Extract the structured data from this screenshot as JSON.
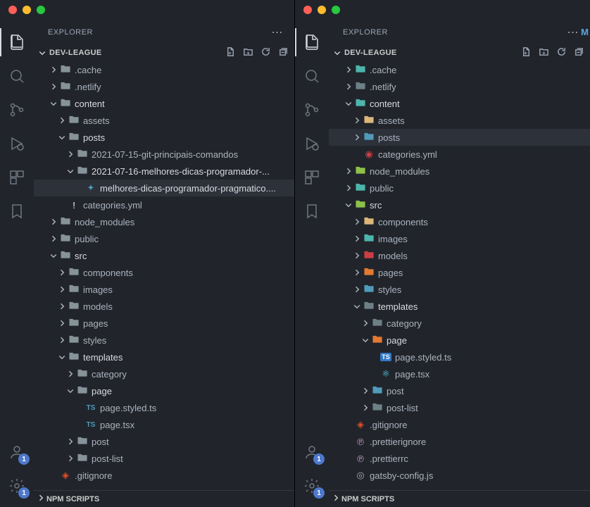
{
  "windows": [
    {
      "explorer_title": "EXPLORER",
      "project_name": "DEV-LEAGUE",
      "npm_scripts": "NPM SCRIPTS",
      "account_badge": "1",
      "settings_badge": "1",
      "tree": [
        {
          "indent": 1,
          "chev": "right",
          "icon": "folder-default",
          "name": ".cache"
        },
        {
          "indent": 1,
          "chev": "right",
          "icon": "folder-default",
          "name": ".netlify"
        },
        {
          "indent": 1,
          "chev": "down",
          "icon": "folder-default",
          "name": "content",
          "bright": true
        },
        {
          "indent": 2,
          "chev": "right",
          "icon": "folder-default",
          "name": "assets"
        },
        {
          "indent": 2,
          "chev": "down",
          "icon": "folder-default",
          "name": "posts",
          "bright": true
        },
        {
          "indent": 3,
          "chev": "right",
          "icon": "folder-default",
          "name": "2021-07-15-git-principais-comandos"
        },
        {
          "indent": 3,
          "chev": "down",
          "icon": "folder-default",
          "name": "2021-07-16-melhores-dicas-programador-...",
          "bright": true
        },
        {
          "indent": 4,
          "chev": "none",
          "icon": "md",
          "name": "melhores-dicas-programador-pragmatico....",
          "selected": true,
          "bright": true
        },
        {
          "indent": 2,
          "chev": "none",
          "icon": "yml",
          "name": "categories.yml"
        },
        {
          "indent": 1,
          "chev": "right",
          "icon": "folder-default",
          "name": "node_modules"
        },
        {
          "indent": 1,
          "chev": "right",
          "icon": "folder-default",
          "name": "public"
        },
        {
          "indent": 1,
          "chev": "down",
          "icon": "folder-default",
          "name": "src",
          "bright": true
        },
        {
          "indent": 2,
          "chev": "right",
          "icon": "folder-default",
          "name": "components"
        },
        {
          "indent": 2,
          "chev": "right",
          "icon": "folder-default",
          "name": "images"
        },
        {
          "indent": 2,
          "chev": "right",
          "icon": "folder-default",
          "name": "models"
        },
        {
          "indent": 2,
          "chev": "right",
          "icon": "folder-default",
          "name": "pages"
        },
        {
          "indent": 2,
          "chev": "right",
          "icon": "folder-default",
          "name": "styles"
        },
        {
          "indent": 2,
          "chev": "down",
          "icon": "folder-default",
          "name": "templates",
          "bright": true
        },
        {
          "indent": 3,
          "chev": "right",
          "icon": "folder-default",
          "name": "category"
        },
        {
          "indent": 3,
          "chev": "down",
          "icon": "folder-default",
          "name": "page",
          "bright": true
        },
        {
          "indent": 4,
          "chev": "none",
          "icon": "ts",
          "name": "page.styled.ts"
        },
        {
          "indent": 4,
          "chev": "none",
          "icon": "ts",
          "name": "page.tsx"
        },
        {
          "indent": 3,
          "chev": "right",
          "icon": "folder-default",
          "name": "post"
        },
        {
          "indent": 3,
          "chev": "right",
          "icon": "folder-default",
          "name": "post-list"
        },
        {
          "indent": 1,
          "chev": "none",
          "icon": "git",
          "name": ".gitignore"
        }
      ]
    },
    {
      "explorer_title": "EXPLORER",
      "project_name": "DEV-LEAGUE",
      "npm_scripts": "NPM SCRIPTS",
      "editor_peek": "M",
      "account_badge": "1",
      "settings_badge": "1",
      "tree": [
        {
          "indent": 1,
          "chev": "right",
          "icon": "folder-teal",
          "name": ".cache"
        },
        {
          "indent": 1,
          "chev": "right",
          "icon": "folder-gray",
          "name": ".netlify"
        },
        {
          "indent": 1,
          "chev": "down",
          "icon": "folder-teal",
          "name": "content",
          "bright": true
        },
        {
          "indent": 2,
          "chev": "right",
          "icon": "folder-yellow",
          "name": "assets"
        },
        {
          "indent": 2,
          "chev": "right",
          "icon": "folder-blue",
          "name": "posts",
          "selected": true
        },
        {
          "indent": 2,
          "chev": "none",
          "icon": "yml-red",
          "name": "categories.yml"
        },
        {
          "indent": 1,
          "chev": "right",
          "icon": "folder-green",
          "name": "node_modules"
        },
        {
          "indent": 1,
          "chev": "right",
          "icon": "folder-teal",
          "name": "public"
        },
        {
          "indent": 1,
          "chev": "down",
          "icon": "folder-green",
          "name": "src",
          "bright": true
        },
        {
          "indent": 2,
          "chev": "right",
          "icon": "folder-yellow",
          "name": "components"
        },
        {
          "indent": 2,
          "chev": "right",
          "icon": "folder-teal",
          "name": "images"
        },
        {
          "indent": 2,
          "chev": "right",
          "icon": "folder-red",
          "name": "models"
        },
        {
          "indent": 2,
          "chev": "right",
          "icon": "folder-orange",
          "name": "pages"
        },
        {
          "indent": 2,
          "chev": "right",
          "icon": "folder-blue",
          "name": "styles"
        },
        {
          "indent": 2,
          "chev": "down",
          "icon": "folder-gray",
          "name": "templates",
          "bright": true
        },
        {
          "indent": 3,
          "chev": "right",
          "icon": "folder-gray",
          "name": "category"
        },
        {
          "indent": 3,
          "chev": "down",
          "icon": "folder-orange",
          "name": "page",
          "bright": true
        },
        {
          "indent": 4,
          "chev": "none",
          "icon": "ts-blue",
          "name": "page.styled.ts"
        },
        {
          "indent": 4,
          "chev": "none",
          "icon": "react",
          "name": "page.tsx"
        },
        {
          "indent": 3,
          "chev": "right",
          "icon": "folder-blue",
          "name": "post"
        },
        {
          "indent": 3,
          "chev": "right",
          "icon": "folder-gray",
          "name": "post-list"
        },
        {
          "indent": 1,
          "chev": "none",
          "icon": "git",
          "name": ".gitignore"
        },
        {
          "indent": 1,
          "chev": "none",
          "icon": "prettier",
          "name": ".prettierignore"
        },
        {
          "indent": 1,
          "chev": "none",
          "icon": "prettier",
          "name": ".prettierrc"
        },
        {
          "indent": 1,
          "chev": "none",
          "icon": "gatsby",
          "name": "gatsby-config.js"
        }
      ]
    }
  ]
}
